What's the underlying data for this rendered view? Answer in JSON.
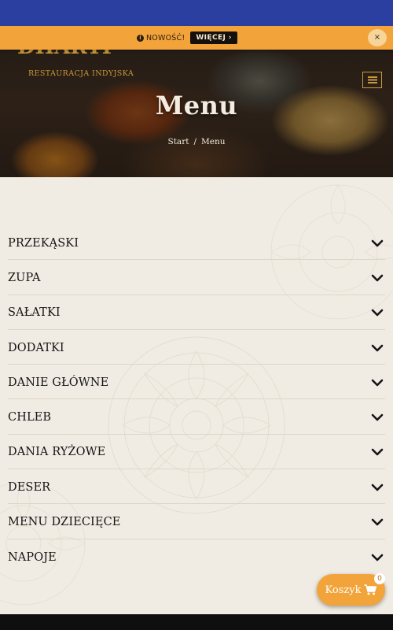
{
  "brand": {
    "name": "DHARTI",
    "tagline": "RESTAURACJA INDYJSKA"
  },
  "notice": {
    "text": "NOWOŚĆ!",
    "button_label": "WIĘCEJ ›",
    "close_label": "×",
    "icon": "info-icon"
  },
  "hero": {
    "title": "Menu",
    "breadcrumb": [
      "Start",
      "Menu"
    ],
    "separator": "/"
  },
  "menu": {
    "categories": [
      "PRZEKĄSKI",
      "ZUPA",
      "SAŁATKI",
      "DODATKI",
      "DANIE GŁÓWNE",
      "CHLEB",
      "DANIA RYŻOWE",
      "DESER",
      "MENU DZIECIĘCE",
      "NAPOJE"
    ],
    "expand_icon": "chevron-down-icon"
  },
  "cart": {
    "label": "Koszyk",
    "count": "0",
    "icon": "cart-icon"
  },
  "colors": {
    "top_strip": "#2a3fa0",
    "accent_orange": "#f2a43a",
    "gold": "#c99a3c",
    "background": "#f1ece3",
    "text": "#151515"
  }
}
